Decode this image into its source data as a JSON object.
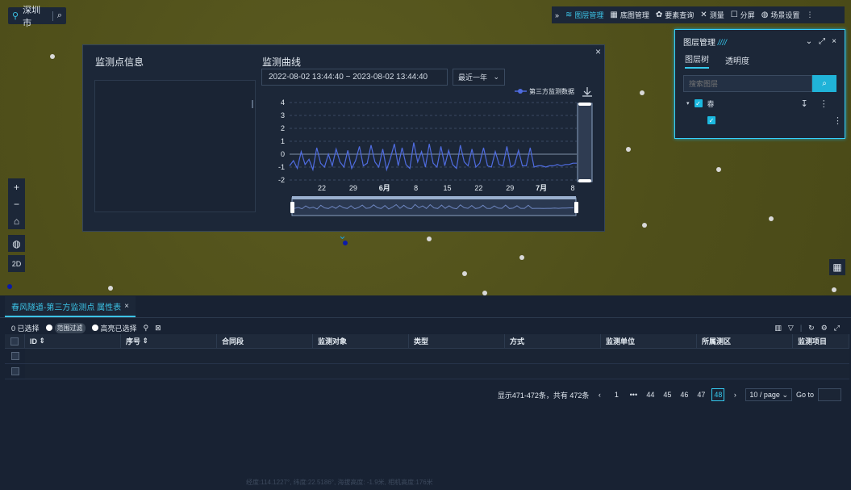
{
  "city": {
    "name": "深圳市"
  },
  "toolbar": {
    "collapse": "»",
    "items": [
      {
        "label": "图层管理",
        "icon": "layers-icon",
        "active": true
      },
      {
        "label": "底图管理",
        "icon": "grid-icon",
        "active": false
      },
      {
        "label": "要素查询",
        "icon": "query-icon",
        "active": false
      },
      {
        "label": "测量",
        "icon": "ruler-icon",
        "active": false
      },
      {
        "label": "分屏",
        "icon": "split-icon",
        "active": false
      },
      {
        "label": "场景设置",
        "icon": "globe-icon",
        "active": false
      }
    ],
    "more": "⋮"
  },
  "left_controls": {
    "zoom_in": "+",
    "zoom_out": "−",
    "home": "⌂",
    "globe": "◍",
    "mode": "2D"
  },
  "popup": {
    "info_title": "监测点信息",
    "curve_title": "监测曲线",
    "date_range": "2022-08-02 13:44:40 ~ 2023-08-02 13:44:40",
    "range_select": "最近一年",
    "legend": "第三方监测数据"
  },
  "chart_data": {
    "type": "line",
    "series": [
      {
        "name": "第三方监测数据",
        "values": [
          -0.9,
          -0.5,
          -1.1,
          0.2,
          -0.8,
          -0.4,
          -1.2,
          0.5,
          -0.7,
          -1.0,
          0.0,
          -0.9,
          0.4,
          -0.6,
          -1.0,
          0.3,
          -1.1,
          -0.5,
          0.6,
          -0.9,
          -0.7,
          0.7,
          -0.6,
          -1.0,
          0.4,
          -1.2,
          -0.3,
          0.8,
          -0.9,
          0.5,
          -0.8,
          -1.1,
          0.9,
          -0.6,
          0.2,
          -1.0,
          0.8,
          -0.7,
          -1.0,
          0.6,
          -0.9,
          0.3,
          -0.8,
          -1.1,
          0.7,
          -0.6,
          -0.9,
          0.4,
          -1.0,
          -0.7,
          0.5,
          -0.9,
          -1.0,
          0.2,
          -0.8,
          -0.9,
          0.6,
          -1.0,
          -0.8,
          0.3,
          -0.9,
          -0.9,
          0.5,
          -1.0,
          -0.9,
          -0.9,
          -1.0,
          -0.9,
          -0.9,
          -0.8,
          -0.9,
          -0.8,
          -0.8,
          -0.7,
          -0.7
        ]
      }
    ],
    "x_ticks": [
      "22",
      "29",
      "6月",
      "8",
      "15",
      "22",
      "29",
      "7月",
      "8"
    ],
    "y_ticks": [
      "4",
      "3",
      "2",
      "1",
      "0",
      "-1",
      "-2"
    ],
    "ylim": [
      -2,
      4
    ],
    "grid": true
  },
  "layer_panel": {
    "title": "图层管理",
    "tabs": [
      "图层树",
      "透明度"
    ],
    "search_placeholder": "搜索图层",
    "node_root": "春",
    "node_child": ""
  },
  "attr_table": {
    "tab_label": "春风隧道-第三方监测点 属性表",
    "selected_count": "0 已选择",
    "filter_label": "范围过滤",
    "highlight_label": "高亮已选择",
    "columns": [
      "ID",
      "序号",
      "合同段",
      "监测对象",
      "类型",
      "方式",
      "监测单位",
      "所属测区",
      "监测项目"
    ],
    "pagination": {
      "summary": "显示471-472条，共有 472条",
      "pages": [
        "1",
        "44",
        "45",
        "46",
        "47",
        "48"
      ],
      "ellipsis": "•••",
      "current": "48",
      "page_size": "10 / page",
      "goto_label": "Go to"
    }
  },
  "status_bar": {
    "text": "经度:114.1227°, 纬度:22.5186°, 海拔高度: -1.9米, 相机高度:176米"
  }
}
